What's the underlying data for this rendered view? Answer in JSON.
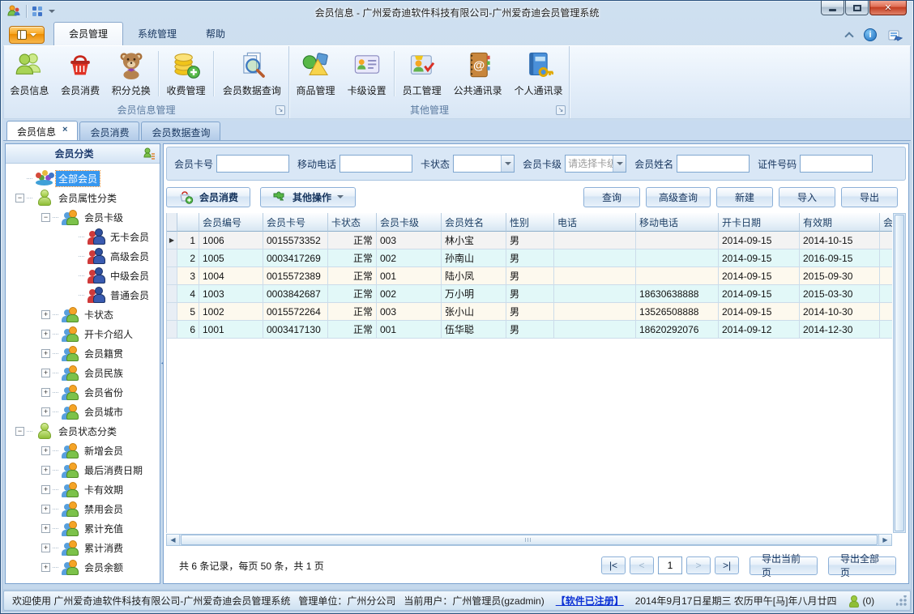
{
  "window": {
    "title": "会员信息 - 广州爱奇迪软件科技有限公司-广州爱奇迪会员管理系统"
  },
  "ribbon": {
    "tabs": [
      {
        "label": "会员管理",
        "active": true
      },
      {
        "label": "系统管理",
        "active": false
      },
      {
        "label": "帮助",
        "active": false
      }
    ],
    "groups": [
      {
        "label": "会员信息管理",
        "buttons": [
          "会员信息",
          "会员消费",
          "积分兑换",
          "收费管理",
          "会员数据查询"
        ]
      },
      {
        "label": "其他管理",
        "buttons": [
          "商品管理",
          "卡级设置",
          "员工管理",
          "公共通讯录",
          "个人通讯录"
        ]
      }
    ]
  },
  "doc_tabs": [
    {
      "label": "会员信息",
      "active": true,
      "close": "×"
    },
    {
      "label": "会员消费",
      "active": false
    },
    {
      "label": "会员数据查询",
      "active": false
    }
  ],
  "sidebar": {
    "header": "会员分类",
    "tree": [
      {
        "lvl": 0,
        "tog": "none",
        "ico": "group",
        "label": "全部会员",
        "sel": true
      },
      {
        "lvl": 0,
        "tog": "minus",
        "ico": "green",
        "label": "会员属性分类"
      },
      {
        "lvl": 1,
        "tog": "minus",
        "ico": "orange",
        "label": "会员卡级"
      },
      {
        "lvl": 2,
        "tog": "none",
        "ico": "pair",
        "label": "无卡会员"
      },
      {
        "lvl": 2,
        "tog": "none",
        "ico": "pair",
        "label": "高级会员"
      },
      {
        "lvl": 2,
        "tog": "none",
        "ico": "pair",
        "label": "中级会员"
      },
      {
        "lvl": 2,
        "tog": "none",
        "ico": "pair",
        "label": "普通会员"
      },
      {
        "lvl": 1,
        "tog": "plus",
        "ico": "orange",
        "label": "卡状态"
      },
      {
        "lvl": 1,
        "tog": "plus",
        "ico": "orange",
        "label": "开卡介绍人"
      },
      {
        "lvl": 1,
        "tog": "plus",
        "ico": "orange",
        "label": "会员籍贯"
      },
      {
        "lvl": 1,
        "tog": "plus",
        "ico": "orange",
        "label": "会员民族"
      },
      {
        "lvl": 1,
        "tog": "plus",
        "ico": "orange",
        "label": "会员省份"
      },
      {
        "lvl": 1,
        "tog": "plus",
        "ico": "orange",
        "label": "会员城市"
      },
      {
        "lvl": 0,
        "tog": "minus",
        "ico": "green",
        "label": "会员状态分类"
      },
      {
        "lvl": 1,
        "tog": "plus",
        "ico": "orange",
        "label": "新增会员"
      },
      {
        "lvl": 1,
        "tog": "plus",
        "ico": "orange",
        "label": "最后消费日期"
      },
      {
        "lvl": 1,
        "tog": "plus",
        "ico": "orange",
        "label": "卡有效期"
      },
      {
        "lvl": 1,
        "tog": "plus",
        "ico": "orange",
        "label": "禁用会员"
      },
      {
        "lvl": 1,
        "tog": "plus",
        "ico": "orange",
        "label": "累计充值"
      },
      {
        "lvl": 1,
        "tog": "plus",
        "ico": "orange",
        "label": "累计消费"
      },
      {
        "lvl": 1,
        "tog": "plus",
        "ico": "orange",
        "label": "会员余额"
      }
    ]
  },
  "search": {
    "fields": [
      {
        "label": "会员卡号",
        "value": ""
      },
      {
        "label": "移动电话",
        "value": ""
      },
      {
        "label": "卡状态",
        "value": "",
        "kind": "combo"
      },
      {
        "label": "会员卡级",
        "value": "请选择卡级",
        "kind": "combo"
      },
      {
        "label": "会员姓名",
        "value": ""
      },
      {
        "label": "证件号码",
        "value": ""
      }
    ]
  },
  "toolbar": {
    "consume": "会员消费",
    "other_ops": "其他操作",
    "query": "查询",
    "adv_query": "高级查询",
    "create": "新建",
    "import": "导入",
    "export": "导出"
  },
  "table": {
    "columns": [
      "",
      "",
      "会员编号",
      "会员卡号",
      "卡状态",
      "会员卡级",
      "会员姓名",
      "性别",
      "电话",
      "移动电话",
      "开卡日期",
      "有效期",
      "会员"
    ],
    "rows": [
      {
        "num": "1",
        "id": "1006",
        "card": "0015573352",
        "status": "正常",
        "level": "003",
        "name": "林小宝",
        "gender": "男",
        "phone": "",
        "mobile": "",
        "open": "2014-09-15",
        "expire": "2014-10-15",
        "current": true
      },
      {
        "num": "2",
        "id": "1005",
        "card": "0003417269",
        "status": "正常",
        "level": "002",
        "name": "孙南山",
        "gender": "男",
        "phone": "",
        "mobile": "",
        "open": "2014-09-15",
        "expire": "2016-09-15"
      },
      {
        "num": "3",
        "id": "1004",
        "card": "0015572389",
        "status": "正常",
        "level": "001",
        "name": "陆小凤",
        "gender": "男",
        "phone": "",
        "mobile": "",
        "open": "2014-09-15",
        "expire": "2015-09-30"
      },
      {
        "num": "4",
        "id": "1003",
        "card": "0003842687",
        "status": "正常",
        "level": "002",
        "name": "万小明",
        "gender": "男",
        "phone": "",
        "mobile": "18630638888",
        "open": "2014-09-15",
        "expire": "2015-03-30"
      },
      {
        "num": "5",
        "id": "1002",
        "card": "0015572264",
        "status": "正常",
        "level": "003",
        "name": "张小山",
        "gender": "男",
        "phone": "",
        "mobile": "13526508888",
        "open": "2014-09-15",
        "expire": "2014-10-30"
      },
      {
        "num": "6",
        "id": "1001",
        "card": "0003417130",
        "status": "正常",
        "level": "001",
        "name": "伍华聪",
        "gender": "男",
        "phone": "",
        "mobile": "18620292076",
        "open": "2014-09-12",
        "expire": "2014-12-30"
      }
    ]
  },
  "pager": {
    "summary": "共 6 条记录，每页 50 条，共 1 页",
    "first": "|<",
    "prev": "<",
    "page": "1",
    "next": ">",
    "last": ">|",
    "export_page": "导出当前页",
    "export_all": "导出全部页"
  },
  "status": {
    "welcome": "欢迎使用 广州爱奇迪软件科技有限公司-广州爱奇迪会员管理系统",
    "unit": "管理单位：广州分公司",
    "user": "当前用户：广州管理员(gzadmin)",
    "registered": "【软件已注册】",
    "date": "2014年9月17日星期三 农历甲午[马]年八月廿四",
    "messages": "(0)"
  },
  "colors": {
    "accent_orange": "#f7a722",
    "selection_blue": "#3797ef",
    "row_cream": "#fdf9ee",
    "row_cyan": "#e2f8f8",
    "close_red": "#c13a1e"
  }
}
